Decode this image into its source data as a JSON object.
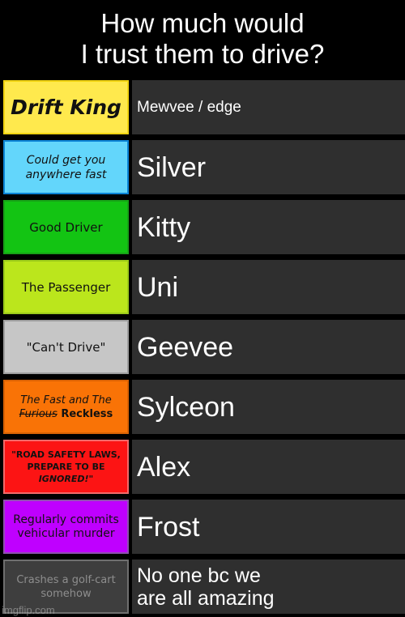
{
  "title": "How much would\nI trust them to drive?",
  "watermark": "imgflip.com",
  "theme": {
    "page_background": "#000000",
    "title_color": "#ffffff",
    "content_cell_background": "#2f2f2f",
    "content_text_color": "#ffffff",
    "label_text_color": "#111111"
  },
  "rows": [
    {
      "tier_label": "Drift King",
      "label_style": "lbl-bigbold",
      "label_background": "#ffe94d",
      "label_border": "#f2d411",
      "content": "Mewvee / edge",
      "content_size": "sz-sm"
    },
    {
      "tier_label": "Could get you anywhere fast",
      "label_style": "lbl-italic",
      "label_background": "#63d6fb",
      "label_border": "#0b84d6",
      "content": "Silver",
      "content_size": "sz-lg"
    },
    {
      "tier_label": "Good Driver",
      "label_style": "lbl-plain",
      "label_background": "#13c413",
      "label_border": "#17a417",
      "content": "Kitty",
      "content_size": "sz-lg"
    },
    {
      "tier_label": "The Passenger",
      "label_style": "lbl-plain",
      "label_background": "#bbe61c",
      "label_border": "#9ccb1a",
      "content": "Uni",
      "content_size": "sz-lg"
    },
    {
      "tier_label": "\"Can't Drive\"",
      "label_style": "lbl-plain",
      "label_background": "#c6c6c6",
      "label_border": "#9d9d9d",
      "content": "Geevee",
      "content_size": "sz-lg"
    },
    {
      "tier_label_parts": [
        {
          "text": "The Fast and The ",
          "style": "ital"
        },
        {
          "text": "Furious",
          "style": "strike"
        },
        {
          "text": " Reckless",
          "style": "bold"
        }
      ],
      "label_style": "lbl-mixed",
      "label_background": "#f97306",
      "label_border": "#d96204",
      "content": "Sylceon",
      "content_size": "sz-lg"
    },
    {
      "tier_label_parts": [
        {
          "text": "\"ROAD SAFETY LAWS, PREPARE TO BE ",
          "style": "bold"
        },
        {
          "text": "IGNORED!",
          "style": "ital"
        },
        {
          "text": "\"",
          "style": "bold"
        }
      ],
      "label_style": "lbl-caps",
      "label_background": "#fc1414",
      "label_border": "#f06a6a",
      "content": "Alex",
      "content_size": "sz-lg"
    },
    {
      "tier_label": "Regularly commits vehicular murder",
      "label_style": "lbl-plain-sm",
      "label_background": "#bf00ff",
      "label_border": "#8f4fb0",
      "content": "Frost",
      "content_size": "sz-lg"
    },
    {
      "tier_label": "Crashes a golf-cart somehow",
      "label_style": "lbl-muted",
      "label_background": "#3e3e3e",
      "label_border": "#6f6f6f",
      "content": "No one bc we\nare all amazing",
      "content_size": "sz-md"
    }
  ]
}
